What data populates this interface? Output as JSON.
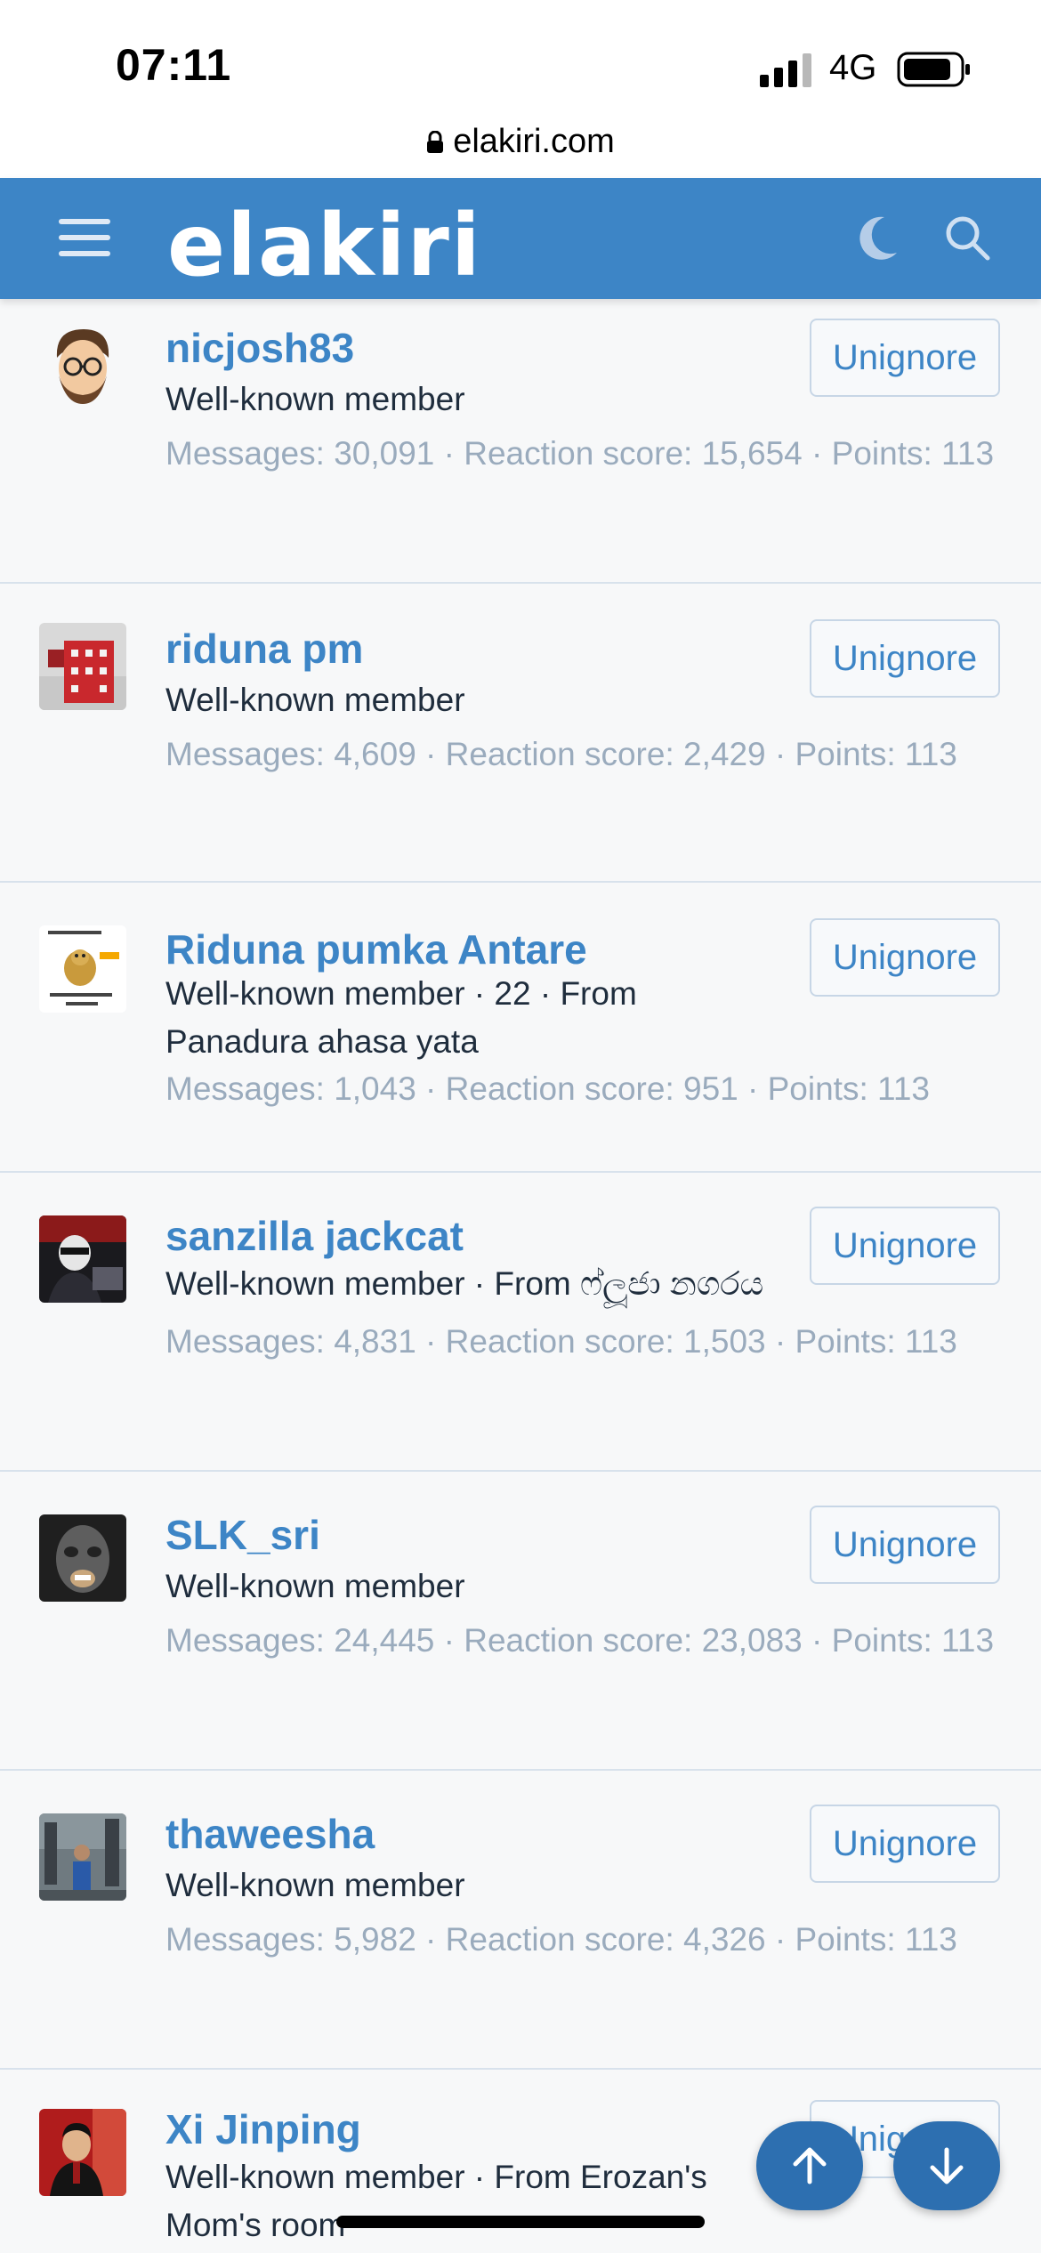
{
  "status": {
    "time": "07:11",
    "network": "4G"
  },
  "browser": {
    "url": "elakiri.com"
  },
  "header": {
    "logo": "elakiri"
  },
  "members": [
    {
      "name": "nicjosh83",
      "meta": "Well-known member",
      "stats": "Messages: 30,091 · Reaction score: 15,654 · Points: 113",
      "button": "Unignore",
      "avatar": "cartoon-man-glasses"
    },
    {
      "name": "riduna pm",
      "meta": "Well-known member",
      "stats": "Messages: 4,609 · Reaction score: 2,429 · Points: 113",
      "button": "Unignore",
      "avatar": "red-building"
    },
    {
      "name": "Riduna pumka Antare",
      "meta": "Well-known member · 22 · From Panadura ahasa yata",
      "stats": "Messages: 1,043 · Reaction score: 951 · Points: 113",
      "button": "Unignore",
      "avatar": "meme-dog"
    },
    {
      "name": "sanzilla jackcat",
      "meta": "Well-known member · From ෆ්ලූජා නගරය",
      "stats": "Messages: 4,831 · Reaction score: 1,503 · Points: 113",
      "button": "Unignore",
      "avatar": "hacker"
    },
    {
      "name": "SLK_sri",
      "meta": "Well-known member",
      "stats": "Messages: 24,445 · Reaction score: 23,083 · Points: 113",
      "button": "Unignore",
      "avatar": "masked-face"
    },
    {
      "name": "thaweesha",
      "meta": "Well-known member",
      "stats": "Messages: 5,982 · Reaction score: 4,326 · Points: 113",
      "button": "Unignore",
      "avatar": "street-photo"
    },
    {
      "name": "Xi Jinping",
      "meta": "Well-known member · From Erozan's Mom's room",
      "stats": "",
      "button": "Unignore",
      "avatar": "man-suit"
    }
  ],
  "colors": {
    "accent": "#3d85c6",
    "muted": "#9aabbd",
    "text": "#1f2d3d"
  }
}
